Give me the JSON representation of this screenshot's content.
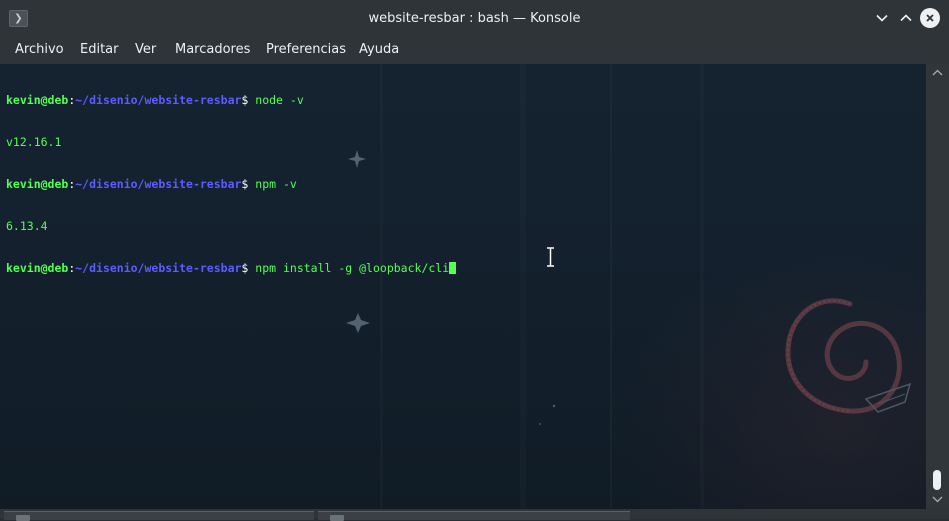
{
  "window": {
    "title": "website-resbar : bash — Konsole",
    "app_icon": "konsole-icon",
    "buttons": [
      "minimize-chevron-icon",
      "maximize-chevron-icon",
      "close-icon"
    ]
  },
  "menu": {
    "items": [
      "Archivo",
      "Editar",
      "Ver",
      "Marcadores",
      "Preferencias",
      "Ayuda"
    ]
  },
  "terminal": {
    "lines": [
      {
        "type": "prompt",
        "user": "kevin@deb",
        "colon": ":",
        "path": "~/disenio/website-resbar",
        "dollar": "$",
        "command": " node -v"
      },
      {
        "type": "output",
        "text": "v12.16.1"
      },
      {
        "type": "prompt",
        "user": "kevin@deb",
        "colon": ":",
        "path": "~/disenio/website-resbar",
        "dollar": "$",
        "command": " npm -v"
      },
      {
        "type": "output",
        "text": "6.13.4"
      },
      {
        "type": "prompt",
        "user": "kevin@deb",
        "colon": ":",
        "path": "~/disenio/website-resbar",
        "dollar": "$",
        "command": " npm install -g @loopback/cli"
      }
    ],
    "colors": {
      "background": "#13202c",
      "user": "#54ff54",
      "path": "#5c5cff",
      "text": "#54ff54"
    },
    "background_logo": "debian-swirl-icon"
  },
  "scrollbar": {
    "position": 1.0
  },
  "tabs": {
    "count": 2
  }
}
